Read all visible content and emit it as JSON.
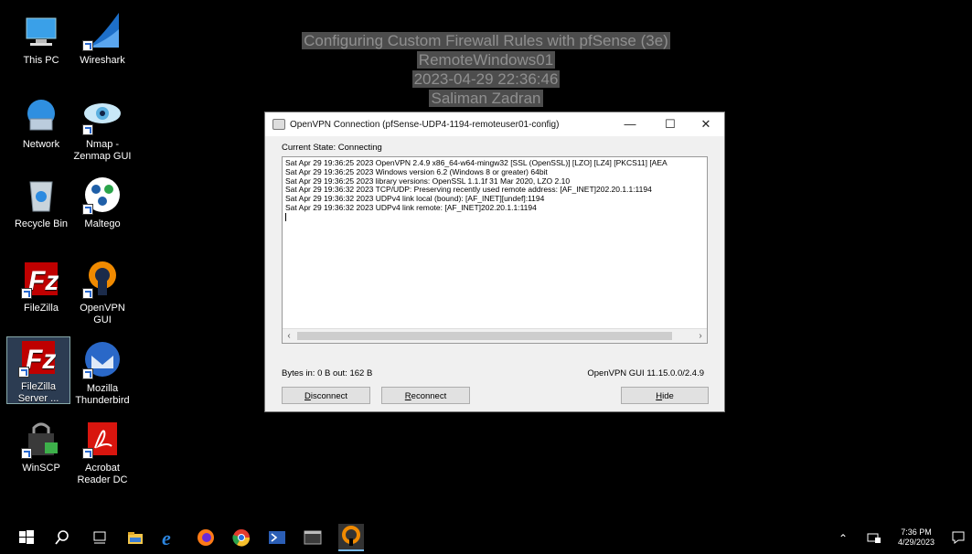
{
  "desktop": {
    "icons": [
      {
        "label_1": "This PC",
        "label_2": ""
      },
      {
        "label_1": "Wireshark",
        "label_2": ""
      },
      {
        "label_1": "Network",
        "label_2": ""
      },
      {
        "label_1": "Nmap -",
        "label_2": "Zenmap GUI"
      },
      {
        "label_1": "Recycle Bin",
        "label_2": ""
      },
      {
        "label_1": "Maltego",
        "label_2": ""
      },
      {
        "label_1": "FileZilla",
        "label_2": ""
      },
      {
        "label_1": "OpenVPN",
        "label_2": "GUI"
      },
      {
        "label_1": "FileZilla",
        "label_2": "Server ..."
      },
      {
        "label_1": "Mozilla",
        "label_2": "Thunderbird"
      },
      {
        "label_1": "WinSCP",
        "label_2": ""
      },
      {
        "label_1": "Acrobat",
        "label_2": "Reader DC"
      }
    ]
  },
  "watermark": {
    "line1": "Configuring Custom Firewall Rules with pfSense (3e)",
    "line2": "RemoteWindows01",
    "line3": "2023-04-29 22:36:46",
    "line4": "Saliman Zadran"
  },
  "window": {
    "title": "OpenVPN Connection (pfSense-UDP4-1194-remoteuser01-config)",
    "minimize": "—",
    "maximize": "☐",
    "close": "✕",
    "current_state": "Current State: Connecting",
    "log": [
      "Sat Apr 29 19:36:25 2023 OpenVPN 2.4.9 x86_64-w64-mingw32 [SSL (OpenSSL)] [LZO] [LZ4] [PKCS11] [AEA",
      "Sat Apr 29 19:36:25 2023 Windows version 6.2 (Windows 8 or greater) 64bit",
      "Sat Apr 29 19:36:25 2023 library versions: OpenSSL 1.1.1f  31 Mar 2020, LZO 2.10",
      "Sat Apr 29 19:36:32 2023 TCP/UDP: Preserving recently used remote address: [AF_INET]202.20.1.1:1194",
      "Sat Apr 29 19:36:32 2023 UDPv4 link local (bound): [AF_INET][undef]:1194",
      "Sat Apr 29 19:36:32 2023 UDPv4 link remote: [AF_INET]202.20.1.1:1194"
    ],
    "bytes": "Bytes in: 0 B  out: 162 B",
    "version": "OpenVPN GUI 11.15.0.0/2.4.9",
    "disconnect_first": "D",
    "disconnect_rest": "isconnect",
    "reconnect_first": "R",
    "reconnect_rest": "econnect",
    "hide_first": "H",
    "hide_rest": "ide"
  },
  "taskbar": {
    "time": "7:36 PM",
    "date": "4/29/2023"
  }
}
